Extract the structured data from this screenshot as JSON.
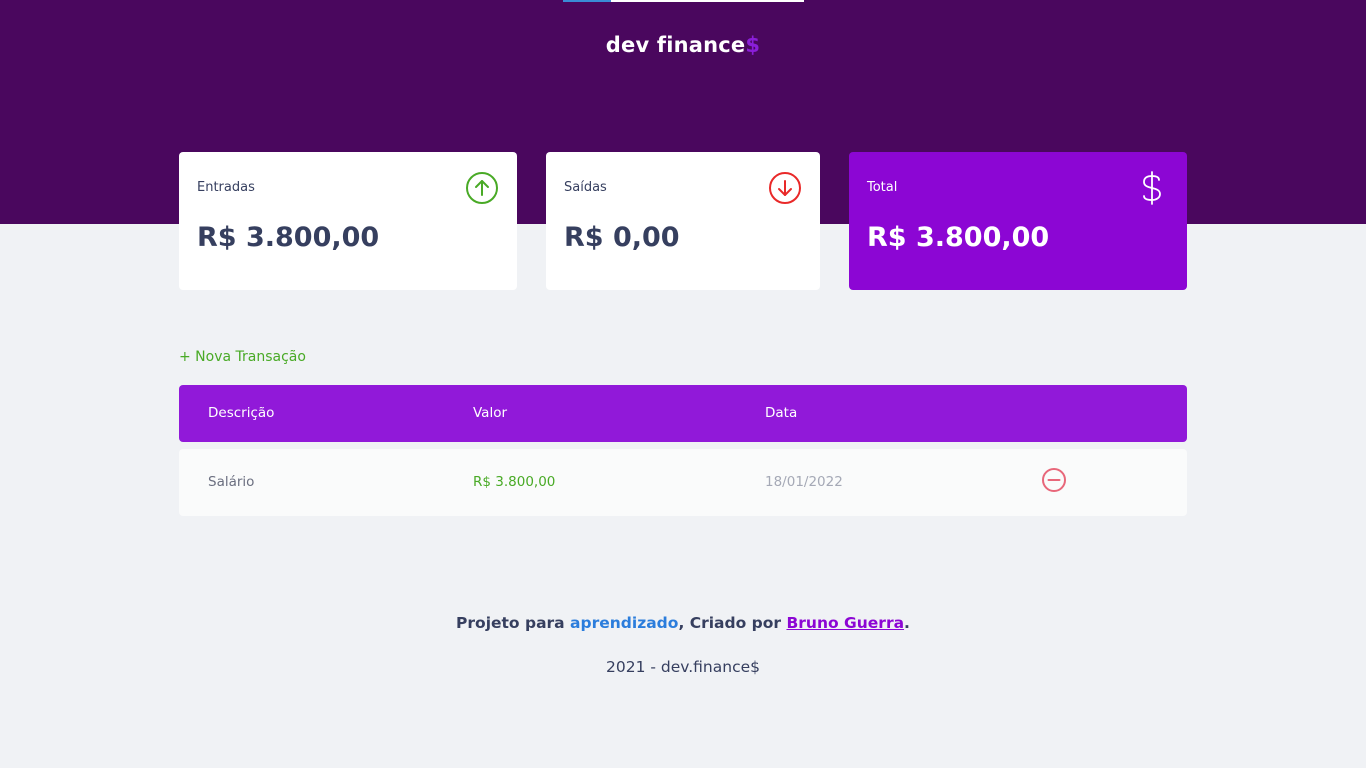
{
  "header": {
    "logo_main": "dev finance",
    "logo_accent": "$",
    "progress": 0.2
  },
  "summary": {
    "income": {
      "label": "Entradas",
      "value": "R$ 3.800,00",
      "icon": "arrow-up-circle-icon",
      "color": "#49aa26"
    },
    "expense": {
      "label": "Saídas",
      "value": "R$ 0,00",
      "icon": "arrow-down-circle-icon",
      "color": "#e92929"
    },
    "total": {
      "label": "Total",
      "value": "R$ 3.800,00",
      "icon": "dollar-icon",
      "color": "#8c06d4"
    }
  },
  "actions": {
    "new_transaction": "+ Nova Transação"
  },
  "table": {
    "headers": [
      "Descrição",
      "Valor",
      "Data"
    ],
    "rows": [
      {
        "description": "Salário",
        "amount": "R$ 3.800,00",
        "date": "18/01/2022",
        "remove_icon": "minus-circle-icon"
      }
    ]
  },
  "footer": {
    "prefix": "Projeto para ",
    "highlight": "aprendizado",
    "middle": ", Criado por ",
    "author": "Bruno Guerra",
    "suffix": ".",
    "copyright": "2021 - dev.finance$"
  },
  "colors": {
    "header_bg": "#4a075e",
    "page_bg": "#f0f2f5",
    "accent_purple": "#8c06d4",
    "income_green": "#49aa26",
    "expense_red": "#e92929",
    "link_blue": "#2b7ddc"
  }
}
